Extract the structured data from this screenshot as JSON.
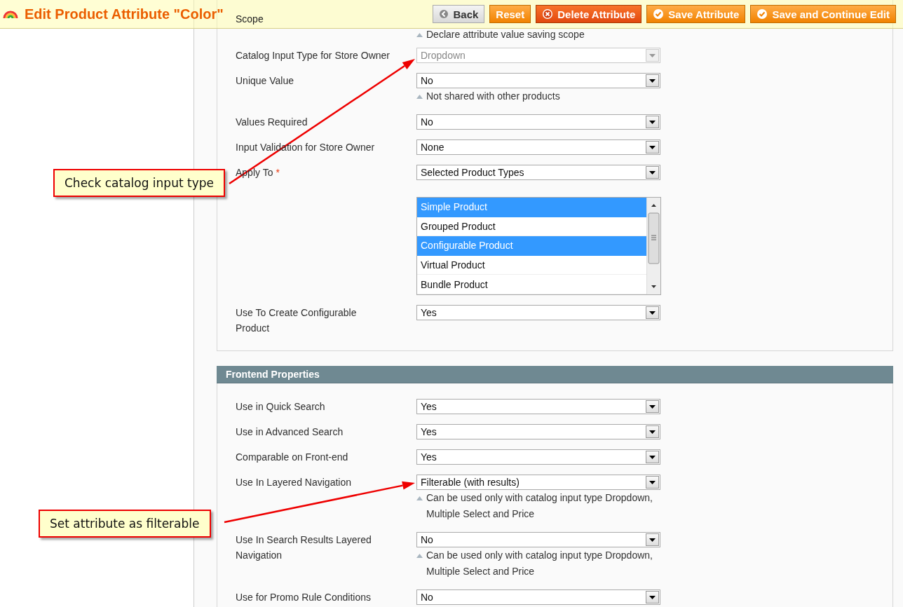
{
  "header": {
    "title": "Edit Product Attribute \"Color\"",
    "buttons": [
      {
        "label": "Back",
        "kind": "back"
      },
      {
        "label": "Reset",
        "kind": "plain"
      },
      {
        "label": "Delete Attribute",
        "kind": "delete"
      },
      {
        "label": "Save Attribute",
        "kind": "save"
      },
      {
        "label": "Save and Continue Edit",
        "kind": "save"
      }
    ]
  },
  "properties": {
    "fields": [
      {
        "label": "Scope",
        "kind": "covered",
        "note": "Declare attribute value saving scope"
      },
      {
        "label": "Catalog Input Type for Store Owner",
        "kind": "select",
        "value": "Dropdown",
        "disabled": true
      },
      {
        "label": "Unique Value",
        "kind": "select",
        "value": "No",
        "disabled": false,
        "note": "Not shared with other products"
      },
      {
        "label": "Values Required",
        "kind": "select",
        "value": "No",
        "disabled": false
      },
      {
        "label": "Input Validation for Store Owner",
        "kind": "select",
        "value": "None",
        "disabled": false
      },
      {
        "label": "Apply To",
        "kind": "select",
        "value": "Selected Product Types",
        "disabled": false,
        "required_mark": "*"
      },
      {
        "kind": "multiselect",
        "options": [
          {
            "label": "Simple Product",
            "selected": true
          },
          {
            "label": "Grouped Product",
            "selected": false
          },
          {
            "label": "Configurable Product",
            "selected": true
          },
          {
            "label": "Virtual Product",
            "selected": false
          },
          {
            "label": "Bundle Product",
            "selected": false
          }
        ]
      },
      {
        "label": "Use To Create Configurable Product",
        "kind": "select",
        "value": "Yes",
        "disabled": false
      }
    ]
  },
  "frontend": {
    "title": "Frontend Properties",
    "fields": [
      {
        "label": "Use in Quick Search",
        "kind": "select",
        "value": "Yes",
        "disabled": false
      },
      {
        "label": "Use in Advanced Search",
        "kind": "select",
        "value": "Yes",
        "disabled": false
      },
      {
        "label": "Comparable on Front-end",
        "kind": "select",
        "value": "Yes",
        "disabled": false
      },
      {
        "label": "Use In Layered Navigation",
        "kind": "select",
        "value": "Filterable (with results)",
        "disabled": false,
        "note": "Can be used only with catalog input type Dropdown, Multiple Select and Price"
      },
      {
        "label": "Use In Search Results Layered Navigation",
        "kind": "select",
        "value": "No",
        "disabled": false,
        "note": "Can be used only with catalog input type Dropdown, Multiple Select and Price"
      },
      {
        "label": "Use for Promo Rule Conditions",
        "kind": "select",
        "value": "No",
        "disabled": false
      }
    ]
  },
  "callouts": [
    {
      "text": "Check catalog input type"
    },
    {
      "text": "Set attribute as filterable"
    }
  ]
}
